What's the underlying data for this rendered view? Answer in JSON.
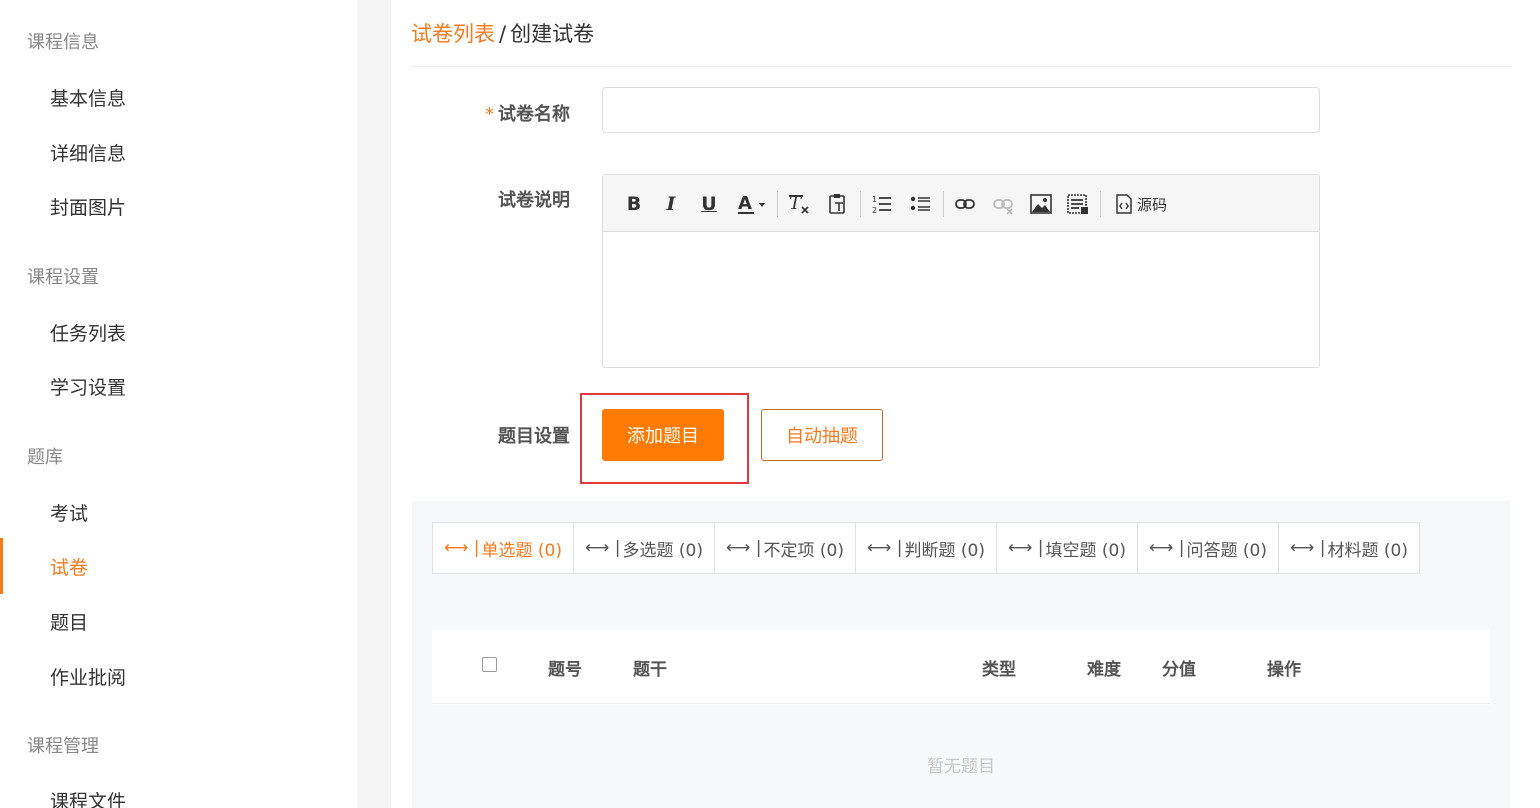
{
  "sidebar": {
    "groups": [
      {
        "label": "课程信息",
        "items": [
          "基本信息",
          "详细信息",
          "封面图片"
        ]
      },
      {
        "label": "课程设置",
        "items": [
          "任务列表",
          "学习设置"
        ]
      },
      {
        "label": "题库",
        "items": [
          "考试",
          "试卷",
          "题目",
          "作业批阅"
        ]
      },
      {
        "label": "课程管理",
        "items": [
          "课程文件"
        ]
      }
    ],
    "active_item": "试卷"
  },
  "breadcrumb": {
    "parent": "试卷列表",
    "separator": "/",
    "current": "创建试卷"
  },
  "form": {
    "name_label": "试卷名称",
    "required_mark": "*",
    "name_value": "",
    "desc_label": "试卷说明",
    "questions_label": "题目设置",
    "add_button": "添加题目",
    "auto_button": "自动抽题"
  },
  "editor": {
    "source_label": "源码",
    "toolbar_icons": [
      "bold-icon",
      "italic-icon",
      "underline-icon",
      "font-color-icon",
      "clear-format-icon",
      "paste-text-icon",
      "ordered-list-icon",
      "unordered-list-icon",
      "link-icon",
      "unlink-icon",
      "image-icon",
      "table-icon",
      "source-code-icon"
    ]
  },
  "question_tabs": [
    {
      "label": "单选题 (0)",
      "active": true
    },
    {
      "label": "多选题 (0)",
      "active": false
    },
    {
      "label": "不定项 (0)",
      "active": false
    },
    {
      "label": "判断题 (0)",
      "active": false
    },
    {
      "label": "填空题 (0)",
      "active": false
    },
    {
      "label": "问答题 (0)",
      "active": false
    },
    {
      "label": "材料题 (0)",
      "active": false
    }
  ],
  "tab_arrow": "⟷ |",
  "table": {
    "headers": {
      "number": "题号",
      "stem": "题干",
      "type": "类型",
      "difficulty": "难度",
      "score": "分值",
      "actions": "操作"
    },
    "empty_text": "暂无题目"
  },
  "colors": {
    "accent": "#f57a1e",
    "primary_button": "#ff7a00",
    "highlight": "#e0393d"
  }
}
